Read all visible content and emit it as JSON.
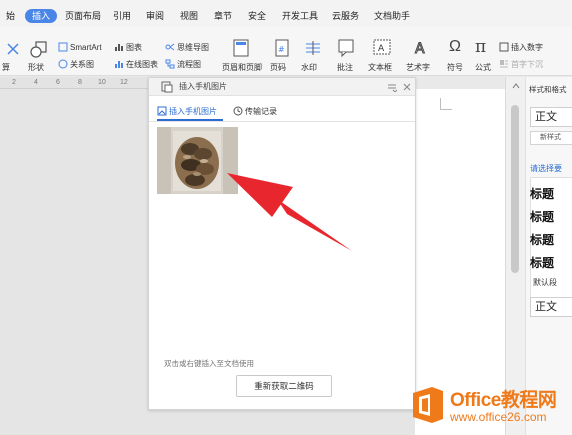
{
  "menubar": {
    "tabs": [
      {
        "label": "始"
      },
      {
        "label": "插入",
        "active": true
      },
      {
        "label": "页面布局"
      },
      {
        "label": "引用"
      },
      {
        "label": "审阅"
      },
      {
        "label": "视图"
      },
      {
        "label": "章节"
      },
      {
        "label": "安全"
      },
      {
        "label": "开发工具"
      },
      {
        "label": "云服务"
      },
      {
        "label": "文档助手"
      }
    ]
  },
  "ribbon": {
    "smartart": "SmartArt",
    "chart": "图表",
    "mindmap": "思维导图",
    "shapes_cut": "算",
    "shapes": "形状",
    "relation": "关系图",
    "online_chart": "在线图表",
    "flowchart": "流程图",
    "header_footer": "页眉和页脚",
    "page_number": "页码",
    "watermark": "水印",
    "comment": "批注",
    "textbox": "文本框",
    "wordart": "艺术字",
    "symbol": "符号",
    "formula": "公式",
    "insert_number": "插入数字",
    "first_drop": "首字下沉",
    "pi_glyph": "π",
    "omega_glyph": "Ω"
  },
  "ruler": {
    "marks": [
      "2",
      "4",
      "6",
      "8",
      "10",
      "12"
    ]
  },
  "panel": {
    "title": "插入手机图片",
    "tab_insert": "插入手机图片",
    "tab_history": "传输记录",
    "hint": "双击或右键插入至文档使用",
    "refresh_button": "重新获取二维码"
  },
  "sidebar": {
    "title": "样式和格式",
    "current_style": "正文",
    "new_style": "新样式",
    "prompt": "请选择要",
    "headings": [
      "标题",
      "标题",
      "标题",
      "标题"
    ],
    "default_para": "默认段",
    "bottom_style": "正文"
  },
  "watermark": {
    "name": "Office教程网",
    "url": "www.office26.com"
  },
  "colors": {
    "accent": "#2b6cd4",
    "tab_active": "#4a86e8",
    "arrow": "#e8262d",
    "watermark": "#ef7a1a"
  }
}
